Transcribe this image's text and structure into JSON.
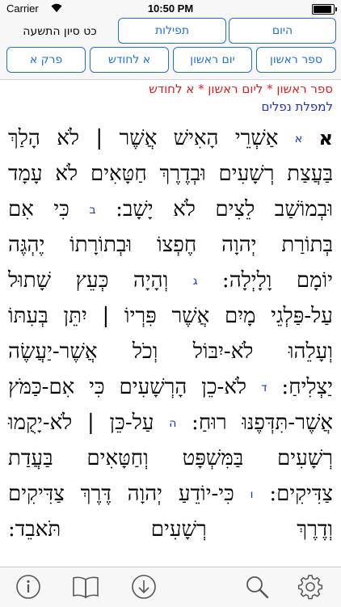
{
  "status_bar": {
    "carrier": "Carrier",
    "time": "10:50 PM"
  },
  "header": {
    "date_label": "כט סיון התשעה",
    "tabs": [
      {
        "label": "תפילות"
      },
      {
        "label": "היום"
      }
    ],
    "nav_buttons": [
      {
        "label": "פרק א"
      },
      {
        "label": "א לחודש"
      },
      {
        "label": "יום ראשון"
      },
      {
        "label": "ספר ראשון"
      }
    ]
  },
  "content": {
    "breadcrumb": "ספר ראשון * ליום ראשון * א לחודש",
    "fallen_link": "למפלת נפלים",
    "chapter_number": "א",
    "lines": [
      {
        "parts": [
          {
            "vn": "א"
          },
          {
            "t": " אַשְׁרֵי הָאִישׁ אֲשֶׁר | לֹא הָלַךְ"
          }
        ]
      },
      {
        "parts": [
          {
            "t": "בַּעֲצַת רְשָׁעִים וּבְדֶרֶךְ חַטָּאִים לֹא עָמָד"
          }
        ]
      },
      {
        "parts": [
          {
            "t": "וּבְמוֹשַׁב לֵצִים לֹא יָשָׁב: "
          },
          {
            "vn": "ב"
          },
          {
            "t": " כִּי אִם"
          }
        ]
      },
      {
        "parts": [
          {
            "t": "בְּתוֹרַת יְהוָה חֶפְצוֹ וּבְתוֹרָתוֹ יֶהְגֶּה"
          }
        ]
      },
      {
        "parts": [
          {
            "t": "יוֹמָם וָלָיְלָה: "
          },
          {
            "vn": "ג"
          },
          {
            "t": " וְהָיָה כְּעֵץ שָׁתוּל"
          }
        ]
      },
      {
        "parts": [
          {
            "t": "עַל-פַּלְגֵי מָיִם אֲשֶׁר פִּרְיוֹ | יִתֵּן בְּעִתּוֹ"
          }
        ]
      },
      {
        "parts": [
          {
            "t": "וְעָלֵהוּ לֹא-יִבּוֹל וְכֹל אֲשֶׁר-יַעֲשֶׂה"
          }
        ]
      },
      {
        "parts": [
          {
            "t": "יַצְלִיחַ: "
          },
          {
            "vn": "ד"
          },
          {
            "t": " לֹא-כֵן הָרְשָׁעִים כִּי אִם-כַּמֹּץ"
          }
        ]
      },
      {
        "parts": [
          {
            "t": "אֲשֶׁר-תִּדְּפֶנּוּ רוּחַ: "
          },
          {
            "vn": "ה"
          },
          {
            "t": " עַל-כֵּן | לֹא-יָקֻמוּ"
          }
        ]
      },
      {
        "parts": [
          {
            "t": "רְשָׁעִים בַּמִּשְׁפָּט וְחַטָּאִים בַּעֲדַת"
          }
        ]
      },
      {
        "parts": [
          {
            "t": "צַדִּיקִים: "
          },
          {
            "vn": "ו"
          },
          {
            "t": " כִּי-יוֹדֵעַ יְהוָה דֶּרֶךְ צַדִּיקִים"
          }
        ]
      },
      {
        "parts": [
          {
            "t": "וְדֶרֶךְ רְשָׁעִים תֹּאבֵד:"
          }
        ]
      }
    ]
  },
  "toolbar": {
    "items": [
      {
        "icon": "info-icon"
      },
      {
        "icon": "book-icon"
      },
      {
        "icon": "download-icon"
      },
      {
        "icon": "search-icon"
      },
      {
        "icon": "gear-icon"
      }
    ]
  },
  "colors": {
    "accent": "#1f6fd8",
    "breadcrumb": "#e21b1b",
    "link": "#1a2fd0",
    "verse_number": "#1a2fd0"
  }
}
